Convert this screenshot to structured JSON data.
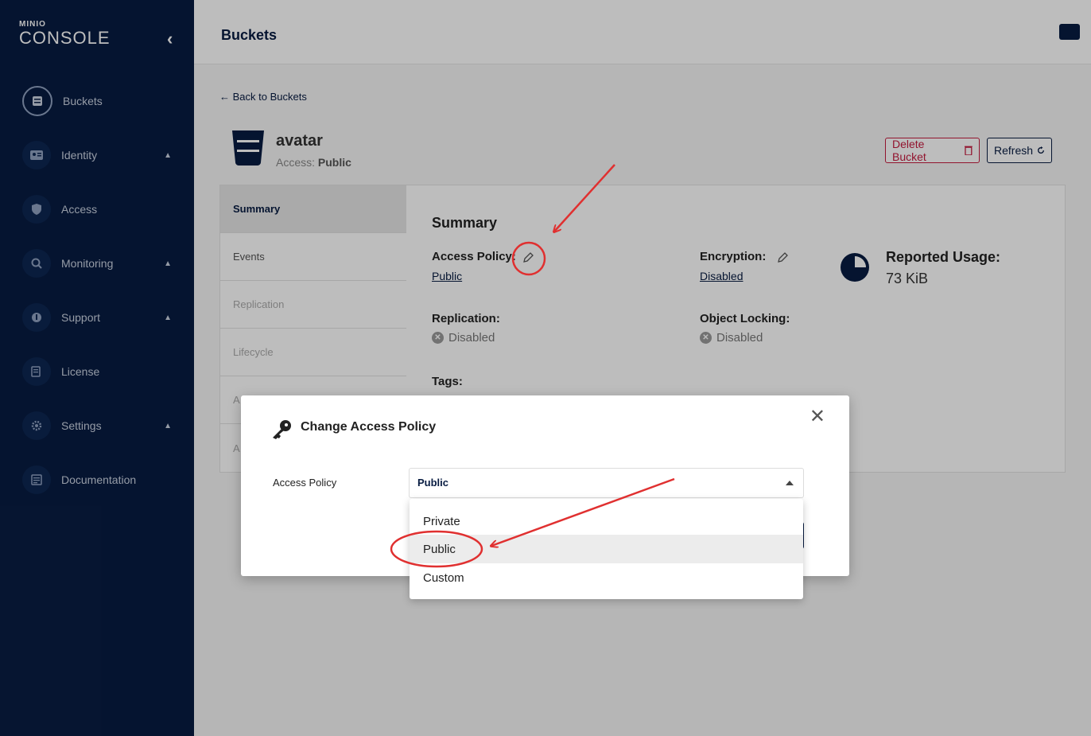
{
  "brand": {
    "small": "MINIO",
    "big": "CONSOLE"
  },
  "sidebar": {
    "items": [
      {
        "label": "Buckets",
        "icon": "bucket-icon"
      },
      {
        "label": "Identity",
        "icon": "id-card-icon"
      },
      {
        "label": "Access",
        "icon": "shield-icon"
      },
      {
        "label": "Monitoring",
        "icon": "magnifier-icon"
      },
      {
        "label": "Support",
        "icon": "support-icon"
      },
      {
        "label": "License",
        "icon": "license-icon"
      },
      {
        "label": "Settings",
        "icon": "gear-icon"
      },
      {
        "label": "Documentation",
        "icon": "document-icon"
      }
    ]
  },
  "header": {
    "title": "Buckets"
  },
  "bucket": {
    "back_label": "Back to Buckets",
    "name": "avatar",
    "access_prefix": "Access: ",
    "access_value": "Public",
    "delete_label": "Delete Bucket",
    "refresh_label": "Refresh"
  },
  "tabs": [
    "Summary",
    "Events",
    "Replication",
    "Lifecycle",
    "A",
    "A"
  ],
  "summary": {
    "heading": "Summary",
    "access_policy_label": "Access Policy:",
    "access_policy_value": "Public",
    "encryption_label": "Encryption:",
    "encryption_value": "Disabled",
    "replication_label": "Replication:",
    "replication_value": "Disabled",
    "object_locking_label": "Object Locking:",
    "object_locking_value": "Disabled",
    "tags_label": "Tags:",
    "usage_label": "Reported Usage:",
    "usage_value": "73 KiB"
  },
  "modal": {
    "title": "Change Access Policy",
    "field_label": "Access Policy",
    "selected": "Public",
    "options": [
      "Private",
      "Public",
      "Custom"
    ]
  },
  "colors": {
    "sidebar_bg": "#081c42",
    "accent": "#081c42",
    "danger": "#c51b3f",
    "annotation": "#e03030"
  }
}
